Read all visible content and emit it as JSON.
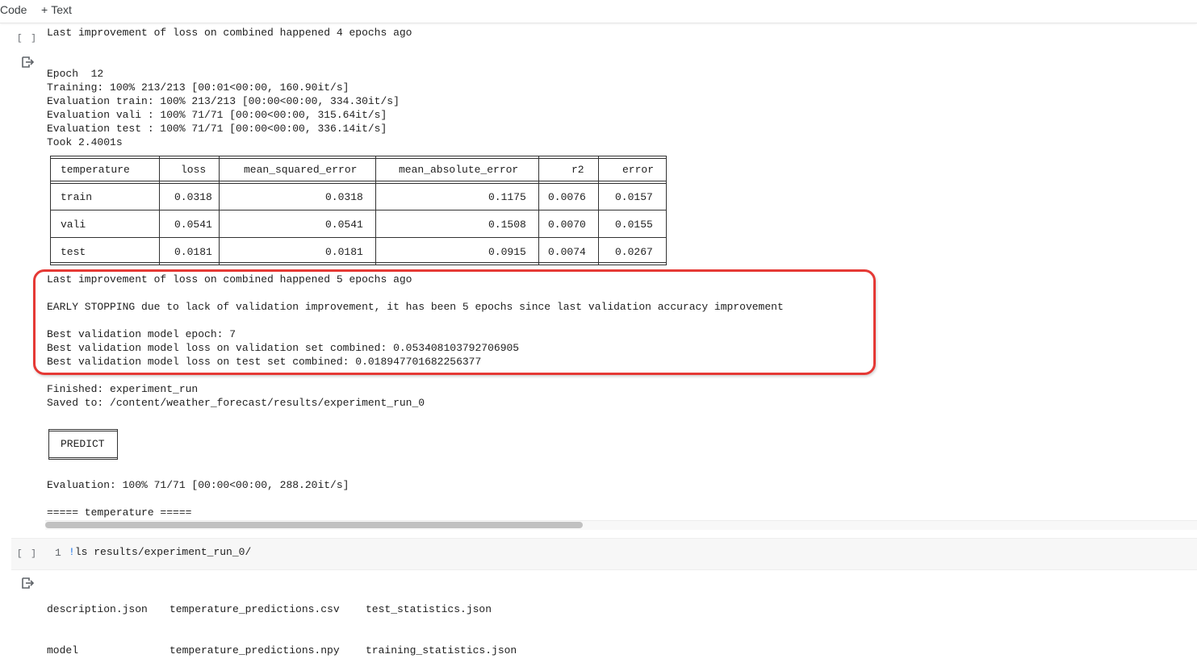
{
  "toolbar": {
    "code_label": "Code",
    "text_label": "Text",
    "plus_glyph": "+"
  },
  "cell1": {
    "run_bracket": "[ ]",
    "code": "Last improvement of loss on combined happened 4 epochs ago"
  },
  "output1": {
    "epoch_line": "Epoch  12",
    "training_line": "Training: 100% 213/213 [00:01<00:00, 160.90it/s]",
    "eval_train_line": "Evaluation train: 100% 213/213 [00:00<00:00, 334.30it/s]",
    "eval_vali_line": "Evaluation vali : 100% 71/71 [00:00<00:00, 315.64it/s]",
    "eval_test_line": "Evaluation test : 100% 71/71 [00:00<00:00, 336.14it/s]",
    "took_line": "Took 2.4001s",
    "table": {
      "headers": [
        "temperature",
        "loss",
        "mean_squared_error",
        "mean_absolute_error",
        "r2",
        "error"
      ],
      "rows": [
        [
          "train",
          "0.0318",
          "0.0318",
          "0.1175",
          "0.0076",
          "0.0157"
        ],
        [
          "vali",
          "0.0541",
          "0.0541",
          "0.1508",
          "0.0070",
          "0.0155"
        ],
        [
          "test",
          "0.0181",
          "0.0181",
          "0.0915",
          "0.0074",
          "0.0267"
        ]
      ]
    },
    "last_improvement_line": "Last improvement of loss on combined happened 5 epochs ago",
    "early_stopping_line": "EARLY STOPPING due to lack of validation improvement, it has been 5 epochs since last validation accuracy improvement",
    "best_epoch_line": "Best validation model epoch: 7",
    "best_vali_loss_line": "Best validation model loss on validation set combined: 0.053408103792706905",
    "best_test_loss_line": "Best validation model loss on test set combined: 0.018947701682256377",
    "finished_line": "Finished: experiment_run",
    "saved_line": "Saved to: /content/weather_forecast/results/experiment_run_0",
    "predict_label": "PREDICT",
    "evaluation_line": "Evaluation: 100% 71/71 [00:00<00:00, 288.20it/s]",
    "temperature_header_line": "===== temperature ====="
  },
  "cell2": {
    "run_bracket": "[ ]",
    "line_number": "1",
    "bang": "!",
    "command": "ls results/experiment_run_0/"
  },
  "output2": {
    "col1": [
      "description.json",
      "model"
    ],
    "col2": [
      "temperature_predictions.csv",
      "temperature_predictions.npy"
    ],
    "col3": [
      "test_statistics.json",
      "training_statistics.json"
    ]
  },
  "colors": {
    "highlight_border": "#e53935",
    "scrollbar_thumb": "#c1c1c1",
    "bang_color": "#1a73e8"
  }
}
